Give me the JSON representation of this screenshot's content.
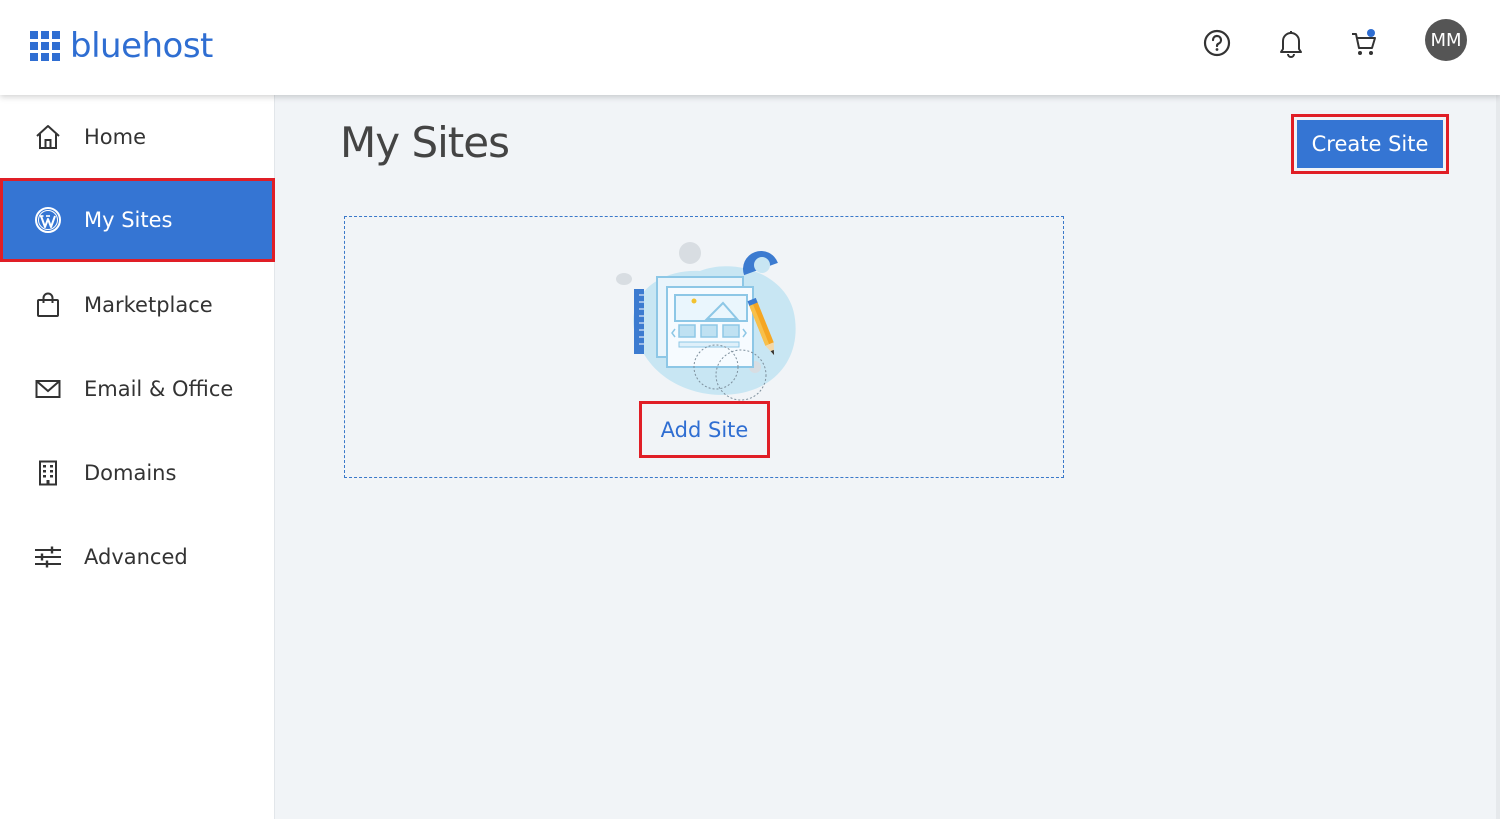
{
  "header": {
    "logo_text": "bluehost",
    "avatar_initials": "MM",
    "icons": [
      "help-icon",
      "bell-icon",
      "cart-icon"
    ]
  },
  "sidebar": {
    "items": [
      {
        "label": "Home",
        "icon": "home-icon"
      },
      {
        "label": "My Sites",
        "icon": "wordpress-icon",
        "active": true
      },
      {
        "label": "Marketplace",
        "icon": "shopping-bag-icon"
      },
      {
        "label": "Email & Office",
        "icon": "mail-icon"
      },
      {
        "label": "Domains",
        "icon": "building-icon"
      },
      {
        "label": "Advanced",
        "icon": "sliders-icon"
      }
    ]
  },
  "main": {
    "title": "My Sites",
    "create_site_label": "Create Site",
    "add_site_label": "Add Site"
  },
  "colors": {
    "brand_blue": "#3575d3",
    "logo_blue": "#2f6ed2",
    "highlight_red": "#e01e26",
    "background": "#f1f4f7"
  }
}
